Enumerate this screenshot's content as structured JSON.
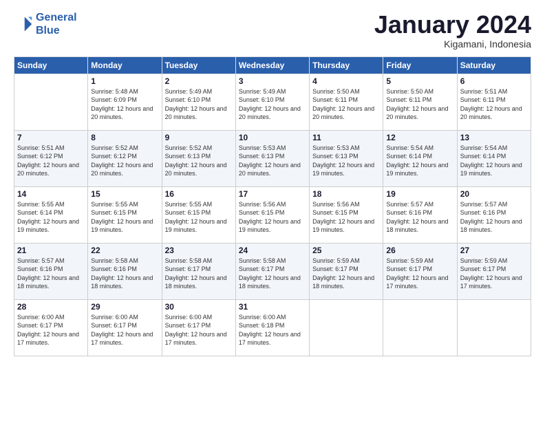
{
  "logo": {
    "line1": "General",
    "line2": "Blue"
  },
  "header": {
    "month": "January 2024",
    "location": "Kigamani, Indonesia"
  },
  "columns": [
    "Sunday",
    "Monday",
    "Tuesday",
    "Wednesday",
    "Thursday",
    "Friday",
    "Saturday"
  ],
  "weeks": [
    [
      {
        "day": "",
        "sunrise": "",
        "sunset": "",
        "daylight": ""
      },
      {
        "day": "1",
        "sunrise": "Sunrise: 5:48 AM",
        "sunset": "Sunset: 6:09 PM",
        "daylight": "Daylight: 12 hours and 20 minutes."
      },
      {
        "day": "2",
        "sunrise": "Sunrise: 5:49 AM",
        "sunset": "Sunset: 6:10 PM",
        "daylight": "Daylight: 12 hours and 20 minutes."
      },
      {
        "day": "3",
        "sunrise": "Sunrise: 5:49 AM",
        "sunset": "Sunset: 6:10 PM",
        "daylight": "Daylight: 12 hours and 20 minutes."
      },
      {
        "day": "4",
        "sunrise": "Sunrise: 5:50 AM",
        "sunset": "Sunset: 6:11 PM",
        "daylight": "Daylight: 12 hours and 20 minutes."
      },
      {
        "day": "5",
        "sunrise": "Sunrise: 5:50 AM",
        "sunset": "Sunset: 6:11 PM",
        "daylight": "Daylight: 12 hours and 20 minutes."
      },
      {
        "day": "6",
        "sunrise": "Sunrise: 5:51 AM",
        "sunset": "Sunset: 6:11 PM",
        "daylight": "Daylight: 12 hours and 20 minutes."
      }
    ],
    [
      {
        "day": "7",
        "sunrise": "Sunrise: 5:51 AM",
        "sunset": "Sunset: 6:12 PM",
        "daylight": "Daylight: 12 hours and 20 minutes."
      },
      {
        "day": "8",
        "sunrise": "Sunrise: 5:52 AM",
        "sunset": "Sunset: 6:12 PM",
        "daylight": "Daylight: 12 hours and 20 minutes."
      },
      {
        "day": "9",
        "sunrise": "Sunrise: 5:52 AM",
        "sunset": "Sunset: 6:13 PM",
        "daylight": "Daylight: 12 hours and 20 minutes."
      },
      {
        "day": "10",
        "sunrise": "Sunrise: 5:53 AM",
        "sunset": "Sunset: 6:13 PM",
        "daylight": "Daylight: 12 hours and 20 minutes."
      },
      {
        "day": "11",
        "sunrise": "Sunrise: 5:53 AM",
        "sunset": "Sunset: 6:13 PM",
        "daylight": "Daylight: 12 hours and 19 minutes."
      },
      {
        "day": "12",
        "sunrise": "Sunrise: 5:54 AM",
        "sunset": "Sunset: 6:14 PM",
        "daylight": "Daylight: 12 hours and 19 minutes."
      },
      {
        "day": "13",
        "sunrise": "Sunrise: 5:54 AM",
        "sunset": "Sunset: 6:14 PM",
        "daylight": "Daylight: 12 hours and 19 minutes."
      }
    ],
    [
      {
        "day": "14",
        "sunrise": "Sunrise: 5:55 AM",
        "sunset": "Sunset: 6:14 PM",
        "daylight": "Daylight: 12 hours and 19 minutes."
      },
      {
        "day": "15",
        "sunrise": "Sunrise: 5:55 AM",
        "sunset": "Sunset: 6:15 PM",
        "daylight": "Daylight: 12 hours and 19 minutes."
      },
      {
        "day": "16",
        "sunrise": "Sunrise: 5:55 AM",
        "sunset": "Sunset: 6:15 PM",
        "daylight": "Daylight: 12 hours and 19 minutes."
      },
      {
        "day": "17",
        "sunrise": "Sunrise: 5:56 AM",
        "sunset": "Sunset: 6:15 PM",
        "daylight": "Daylight: 12 hours and 19 minutes."
      },
      {
        "day": "18",
        "sunrise": "Sunrise: 5:56 AM",
        "sunset": "Sunset: 6:15 PM",
        "daylight": "Daylight: 12 hours and 19 minutes."
      },
      {
        "day": "19",
        "sunrise": "Sunrise: 5:57 AM",
        "sunset": "Sunset: 6:16 PM",
        "daylight": "Daylight: 12 hours and 18 minutes."
      },
      {
        "day": "20",
        "sunrise": "Sunrise: 5:57 AM",
        "sunset": "Sunset: 6:16 PM",
        "daylight": "Daylight: 12 hours and 18 minutes."
      }
    ],
    [
      {
        "day": "21",
        "sunrise": "Sunrise: 5:57 AM",
        "sunset": "Sunset: 6:16 PM",
        "daylight": "Daylight: 12 hours and 18 minutes."
      },
      {
        "day": "22",
        "sunrise": "Sunrise: 5:58 AM",
        "sunset": "Sunset: 6:16 PM",
        "daylight": "Daylight: 12 hours and 18 minutes."
      },
      {
        "day": "23",
        "sunrise": "Sunrise: 5:58 AM",
        "sunset": "Sunset: 6:17 PM",
        "daylight": "Daylight: 12 hours and 18 minutes."
      },
      {
        "day": "24",
        "sunrise": "Sunrise: 5:58 AM",
        "sunset": "Sunset: 6:17 PM",
        "daylight": "Daylight: 12 hours and 18 minutes."
      },
      {
        "day": "25",
        "sunrise": "Sunrise: 5:59 AM",
        "sunset": "Sunset: 6:17 PM",
        "daylight": "Daylight: 12 hours and 18 minutes."
      },
      {
        "day": "26",
        "sunrise": "Sunrise: 5:59 AM",
        "sunset": "Sunset: 6:17 PM",
        "daylight": "Daylight: 12 hours and 17 minutes."
      },
      {
        "day": "27",
        "sunrise": "Sunrise: 5:59 AM",
        "sunset": "Sunset: 6:17 PM",
        "daylight": "Daylight: 12 hours and 17 minutes."
      }
    ],
    [
      {
        "day": "28",
        "sunrise": "Sunrise: 6:00 AM",
        "sunset": "Sunset: 6:17 PM",
        "daylight": "Daylight: 12 hours and 17 minutes."
      },
      {
        "day": "29",
        "sunrise": "Sunrise: 6:00 AM",
        "sunset": "Sunset: 6:17 PM",
        "daylight": "Daylight: 12 hours and 17 minutes."
      },
      {
        "day": "30",
        "sunrise": "Sunrise: 6:00 AM",
        "sunset": "Sunset: 6:17 PM",
        "daylight": "Daylight: 12 hours and 17 minutes."
      },
      {
        "day": "31",
        "sunrise": "Sunrise: 6:00 AM",
        "sunset": "Sunset: 6:18 PM",
        "daylight": "Daylight: 12 hours and 17 minutes."
      },
      {
        "day": "",
        "sunrise": "",
        "sunset": "",
        "daylight": ""
      },
      {
        "day": "",
        "sunrise": "",
        "sunset": "",
        "daylight": ""
      },
      {
        "day": "",
        "sunrise": "",
        "sunset": "",
        "daylight": ""
      }
    ]
  ]
}
